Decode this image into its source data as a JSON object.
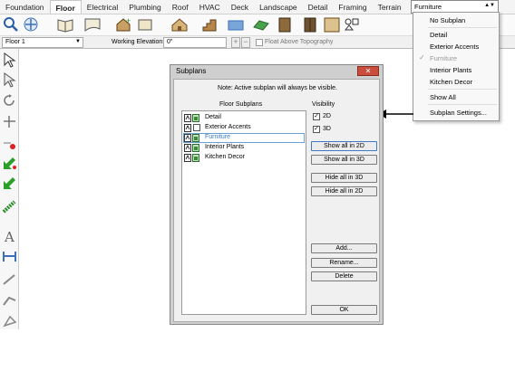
{
  "tabs": [
    "Foundation",
    "Floor",
    "Electrical",
    "Plumbing",
    "Roof",
    "HVAC",
    "Deck",
    "Landscape",
    "Detail",
    "Framing",
    "Terrain"
  ],
  "active_tab": "Floor",
  "subplan_dropdown": {
    "value": "Furniture"
  },
  "subplan_menu": {
    "items": [
      {
        "label": "No Subplan",
        "dim": false
      },
      {
        "label": "Detail",
        "dim": false
      },
      {
        "label": "Exterior Accents",
        "dim": false
      },
      {
        "label": "Furniture",
        "dim": true,
        "checked": true
      },
      {
        "label": "Interior Plants",
        "dim": false
      },
      {
        "label": "Kitchen Decor",
        "dim": false
      },
      {
        "label": "Show All",
        "dim": false
      },
      {
        "label": "Subplan Settings...",
        "dim": false
      }
    ]
  },
  "options_bar": {
    "floor": "Floor 1",
    "working_elevation_label": "Working Elevation:",
    "working_elevation_value": "0\"",
    "float_label": "Float Above Topography"
  },
  "dialog": {
    "title": "Subplans",
    "note": "Note: Active subplan will always be visible.",
    "floor_subplans_label": "Floor Subplans",
    "visibility_label": "Visibility",
    "subplans": [
      {
        "label": "Detail",
        "checked": false
      },
      {
        "label": "Exterior Accents",
        "checked": false
      },
      {
        "label": "Furniture",
        "checked": false,
        "selected": true
      },
      {
        "label": "Interior Plants",
        "checked": false
      },
      {
        "label": "Kitchen Decor",
        "checked": false
      }
    ],
    "visibility": [
      {
        "label": "2D",
        "checked": true
      },
      {
        "label": "3D",
        "checked": true
      }
    ],
    "buttons": {
      "show_all_2d": "Show all in 2D",
      "show_all_3d": "Show all in 3D",
      "hide_all_3d": "Hide all in 3D",
      "hide_all_2d": "Hide all in 2D",
      "add": "Add...",
      "rename": "Rename...",
      "delete": "Delete",
      "ok": "OK"
    }
  }
}
